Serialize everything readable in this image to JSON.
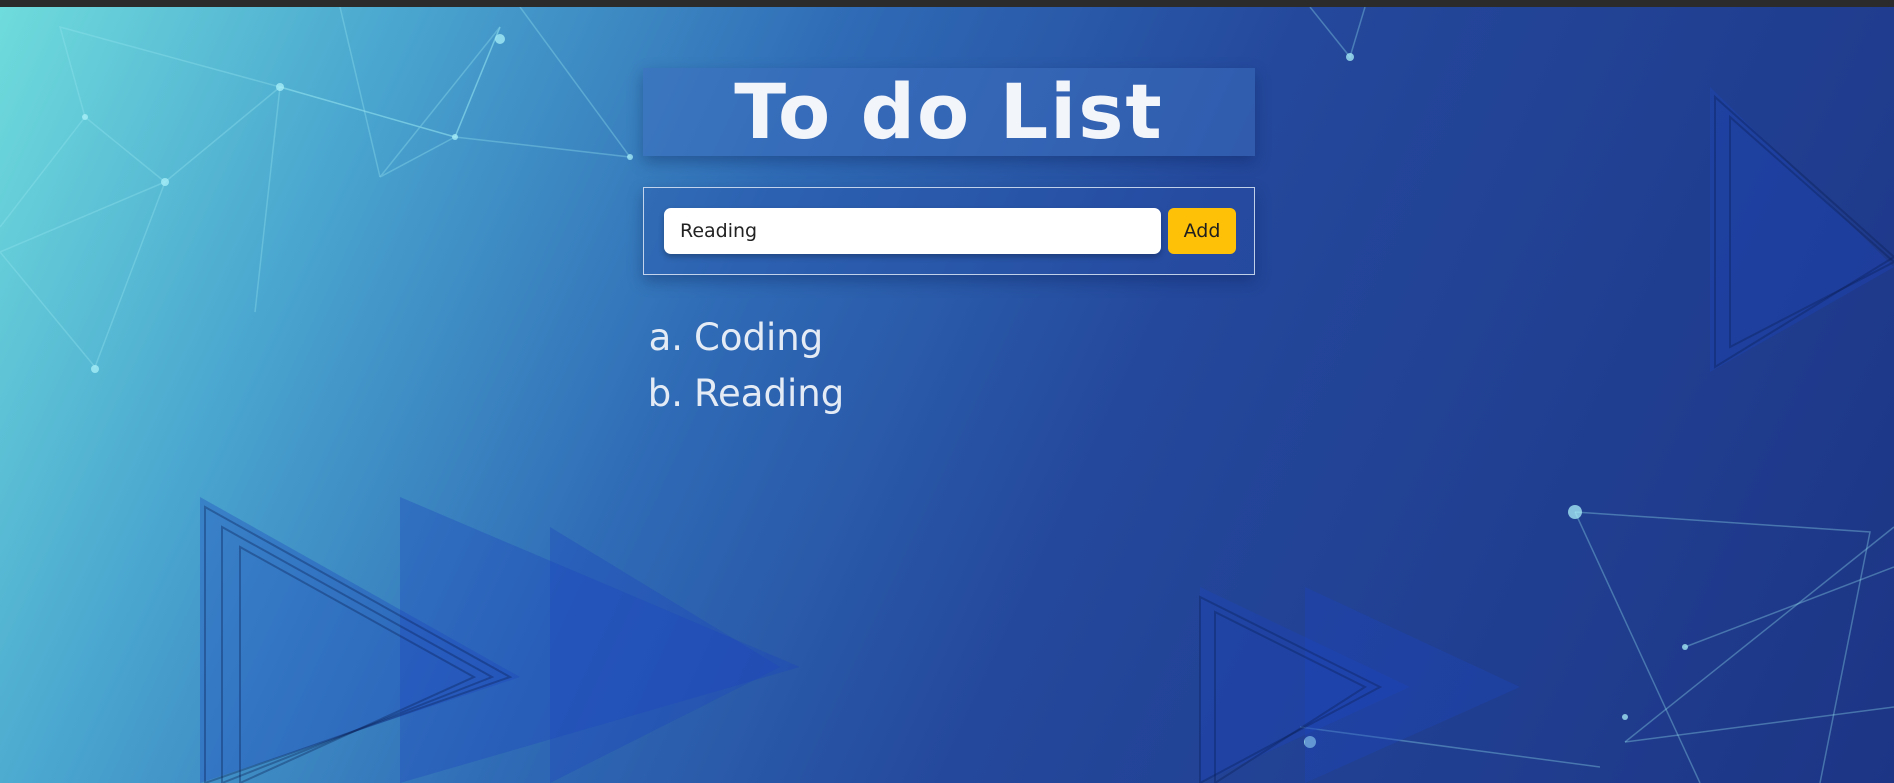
{
  "app": {
    "title": "To do List"
  },
  "form": {
    "input_value": "Reading",
    "add_label": "Add"
  },
  "tasks": [
    {
      "marker": "a.",
      "label": "Coding"
    },
    {
      "marker": "b.",
      "label": "Reading"
    }
  ],
  "colors": {
    "add_button": "#ffc107",
    "title_text": "#f2f5fa",
    "list_text": "#e4ebf5",
    "background_start": "#6fdcdc",
    "background_end": "#1d3585"
  }
}
